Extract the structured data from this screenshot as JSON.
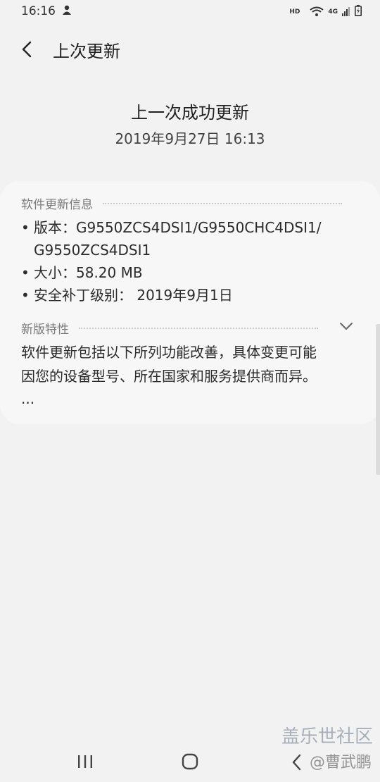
{
  "status": {
    "time": "16:16",
    "hd": "HD",
    "network": "4G"
  },
  "appbar": {
    "title": "上次更新"
  },
  "header": {
    "title": "上一次成功更新",
    "date": "2019年9月27日 16:13"
  },
  "card": {
    "info_section_label": "软件更新信息",
    "version_line1": "版本：G9550ZCS4DSI1/G9550CHC4DSI1/",
    "version_line2": "G9550ZCS4DSI1",
    "size": "大小：58.20 MB",
    "patch": "安全补丁级别： 2019年9月1日",
    "features_label": "新版特性",
    "features_line1": "软件更新包括以下所列功能改善，具体变更可能",
    "features_line2": "因您的设备型号、所在国家和服务提供商而异。",
    "more": "..."
  },
  "watermark": {
    "line1": "盖乐世社区",
    "line2": "@曹武鹏"
  },
  "colors": {
    "background": "#f2f2f2",
    "card": "#f7f7f7",
    "section_label": "#7a7a7a"
  }
}
